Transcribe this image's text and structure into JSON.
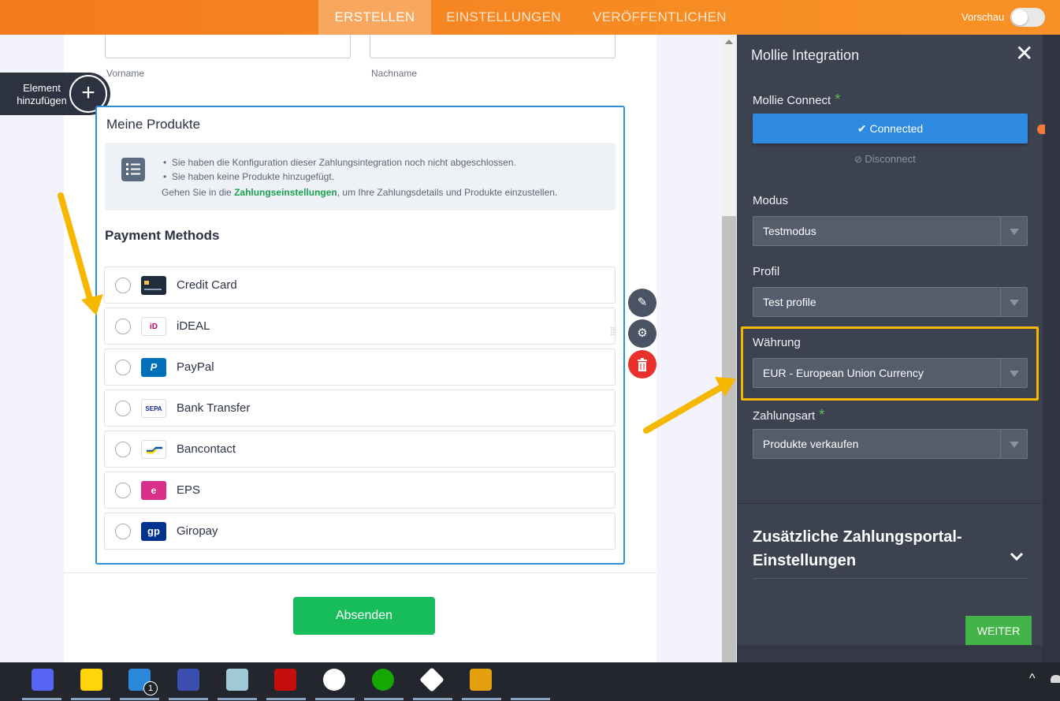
{
  "nav": {
    "tabs": [
      {
        "label": "ERSTELLEN",
        "active": true
      },
      {
        "label": "EINSTELLUNGEN",
        "active": false
      },
      {
        "label": "VERÖFFENTLICHEN",
        "active": false
      }
    ],
    "preview_label": "Vorschau"
  },
  "form": {
    "element_add_label": "Element hinzufügen",
    "firstname_label": "Vorname",
    "lastname_label": "Nachname",
    "products_title": "Meine Produkte",
    "info": {
      "line1": "Sie haben die Konfiguration dieser Zahlungsintegration noch nicht abgeschlossen.",
      "line2": "Sie haben keine Produkte hinzugefügt.",
      "line3_prefix": "Gehen Sie in die ",
      "line3_link": "Zahlungseinstellungen",
      "line3_suffix": ", um Ihre Zahlungsdetails und Produkte einzustellen."
    },
    "payment_methods_title": "Payment Methods",
    "payment_methods": [
      {
        "label": "Credit Card",
        "icon": "credit-card-icon",
        "icon_text": "",
        "bg": "#1f2c3b",
        "fg": "#ffffff"
      },
      {
        "label": "iDEAL",
        "icon": "ideal-icon",
        "icon_text": "iD",
        "bg": "#ffffff",
        "fg": "#cc0066"
      },
      {
        "label": "PayPal",
        "icon": "paypal-icon",
        "icon_text": "P",
        "bg": "#0070ba",
        "fg": "#ffffff"
      },
      {
        "label": "Bank Transfer",
        "icon": "sepa-icon",
        "icon_text": "SEPA",
        "bg": "#ffffff",
        "fg": "#10298e"
      },
      {
        "label": "Bancontact",
        "icon": "bancontact-icon",
        "icon_text": "",
        "bg": "#ffffff",
        "fg": "#005498"
      },
      {
        "label": "EPS",
        "icon": "eps-icon",
        "icon_text": "e",
        "bg": "#d9308a",
        "fg": "#ffffff"
      },
      {
        "label": "Giropay",
        "icon": "giropay-icon",
        "icon_text": "gp",
        "bg": "#00338d",
        "fg": "#ffffff"
      }
    ],
    "submit_label": "Absenden"
  },
  "panel": {
    "title": "Mollie Integration",
    "connect_label": "Mollie Connect",
    "connected_label": "Connected",
    "disconnect_label": "Disconnect",
    "mode_label": "Modus",
    "mode_value": "Testmodus",
    "profile_label": "Profil",
    "profile_value": "Test profile",
    "currency_label": "Währung",
    "currency_value": "EUR - European Union Currency",
    "payment_type_label": "Zahlungsart",
    "payment_type_value": "Produkte verkaufen",
    "extra_title": "Zusätzliche Zahlungsportal-Einstellungen",
    "next_label": "WEITER"
  },
  "taskbar": {
    "badge_count": "1",
    "icons": [
      "discord-icon",
      "sticky-notes-icon",
      "mail-icon",
      "printer-icon",
      "notepad-icon",
      "acrobat-icon",
      "slack-icon",
      "upwork-icon",
      "deepl-icon",
      "plex-icon"
    ]
  },
  "colors": {
    "accent_orange": "#f78b23",
    "panel_bg": "#3c4250",
    "connected_blue": "#2e8ae0",
    "submit_green": "#18bd5b",
    "highlight_yellow": "#f5b700"
  }
}
